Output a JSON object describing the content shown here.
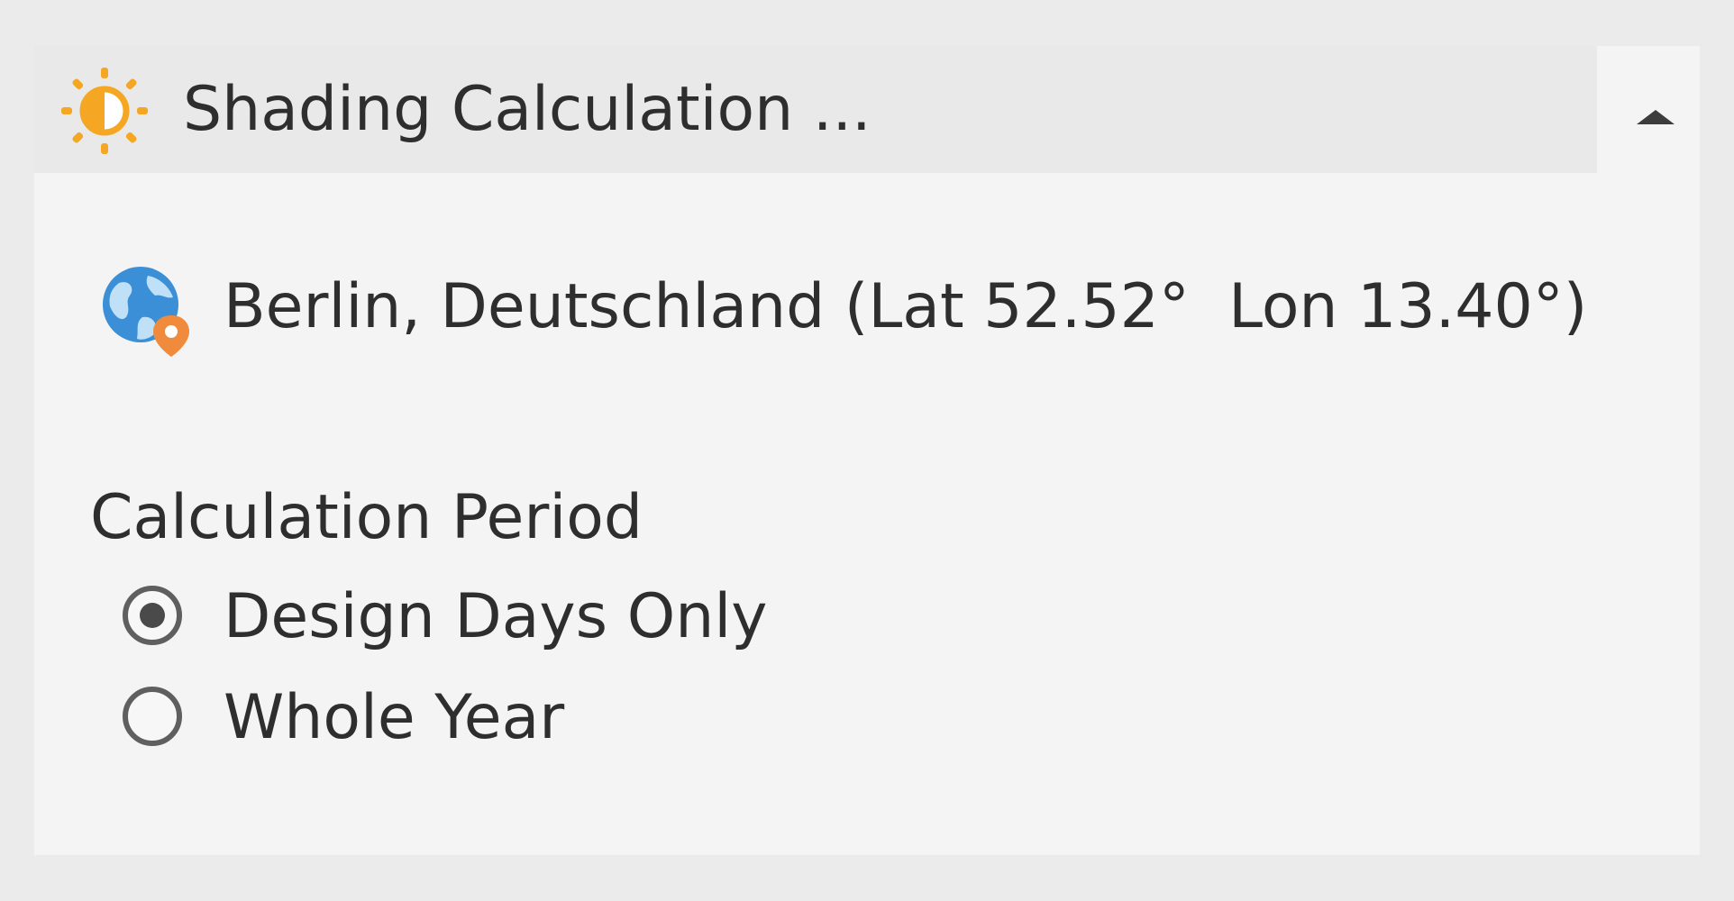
{
  "panel": {
    "title": "Shading Calculation ...",
    "header_icon": "sun-half-icon",
    "collapse_icon": "chevron-up-icon",
    "accent_color": "#f5a623"
  },
  "location": {
    "icon": "globe-location-icon",
    "text": "Berlin, Deutschland (Lat 52.52°  Lon 13.40°)"
  },
  "calculation_period": {
    "label": "Calculation Period",
    "options": [
      {
        "label": "Design Days Only",
        "selected": true
      },
      {
        "label": "Whole Year",
        "selected": false
      }
    ]
  }
}
